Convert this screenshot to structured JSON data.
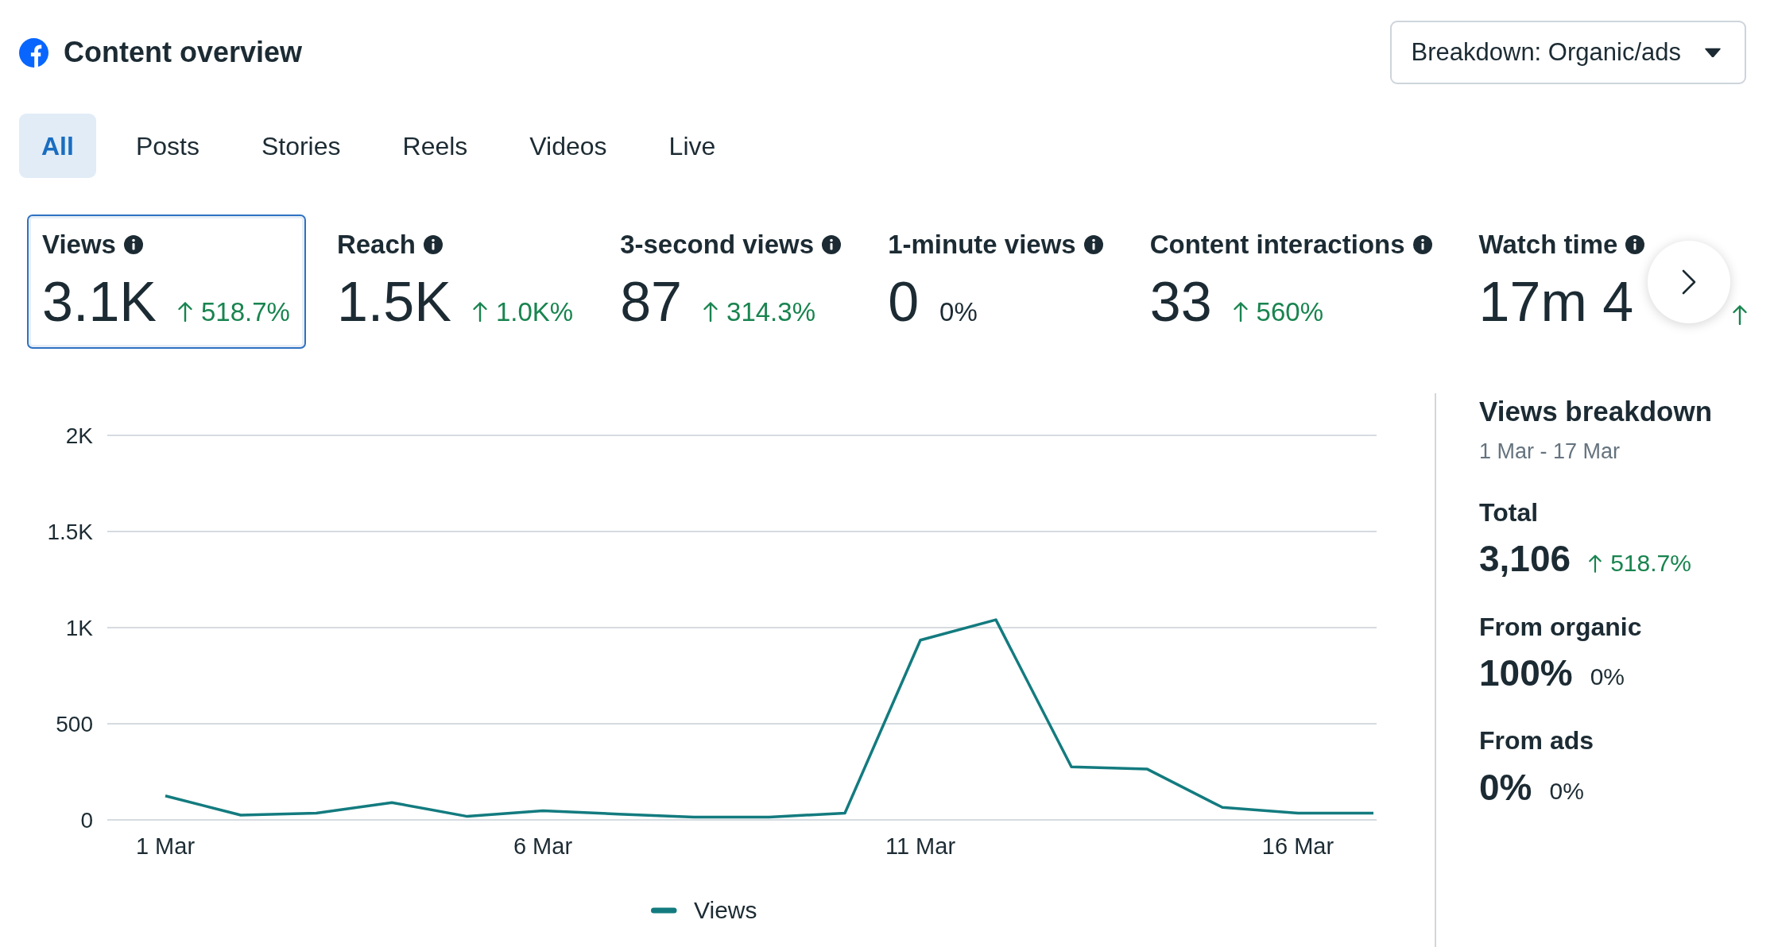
{
  "header": {
    "title": "Content overview",
    "breakdown_dropdown": {
      "label": "Breakdown: Organic/ads"
    }
  },
  "tabs": [
    {
      "label": "All",
      "selected": true
    },
    {
      "label": "Posts",
      "selected": false
    },
    {
      "label": "Stories",
      "selected": false
    },
    {
      "label": "Reels",
      "selected": false
    },
    {
      "label": "Videos",
      "selected": false
    },
    {
      "label": "Live",
      "selected": false
    }
  ],
  "metrics": [
    {
      "label": "Views",
      "value": "3.1K",
      "rising": true,
      "change": "518.7%",
      "selected": true
    },
    {
      "label": "Reach",
      "value": "1.5K",
      "rising": true,
      "change": "1.0K%",
      "selected": false
    },
    {
      "label": "3-second views",
      "value": "87",
      "rising": true,
      "change": "314.3%",
      "selected": false
    },
    {
      "label": "1-minute views",
      "value": "0",
      "rising": false,
      "change": "0%",
      "selected": false
    },
    {
      "label": "Content interactions",
      "value": "33",
      "rising": true,
      "change": "560%",
      "selected": false
    },
    {
      "label": "Watch time",
      "value": "17m 4",
      "rising": true,
      "selected": false
    }
  ],
  "chart": {
    "chart_data": {
      "type": "line",
      "categories": [
        "1 Mar",
        null,
        null,
        null,
        null,
        "6 Mar",
        null,
        null,
        null,
        null,
        "11 Mar",
        null,
        null,
        null,
        null,
        "16 Mar",
        null
      ],
      "series": [
        {
          "name": "Views",
          "color": "#137b7f",
          "values": [
            125,
            25,
            35,
            90,
            18,
            47,
            30,
            15,
            15,
            35,
            935,
            1041,
            276,
            265,
            65,
            35,
            35
          ]
        }
      ],
      "ylim": [
        0,
        2000
      ],
      "yticks": [
        {
          "value": 0,
          "label": "0"
        },
        {
          "value": 500,
          "label": "500"
        },
        {
          "value": 1000,
          "label": "1K"
        },
        {
          "value": 1500,
          "label": "1.5K"
        },
        {
          "value": 2000,
          "label": "2K"
        }
      ],
      "grid": true
    }
  },
  "breakdown_panel": {
    "title": "Views breakdown",
    "date_range": "1 Mar - 17 Mar",
    "rows": [
      {
        "label": "Total",
        "value": "3,106",
        "rising": true,
        "change": "518.7%"
      },
      {
        "label": "From organic",
        "value": "100%",
        "rising": false,
        "change": "0%"
      },
      {
        "label": "From ads",
        "value": "0%",
        "rising": false,
        "change": "0%"
      }
    ]
  }
}
